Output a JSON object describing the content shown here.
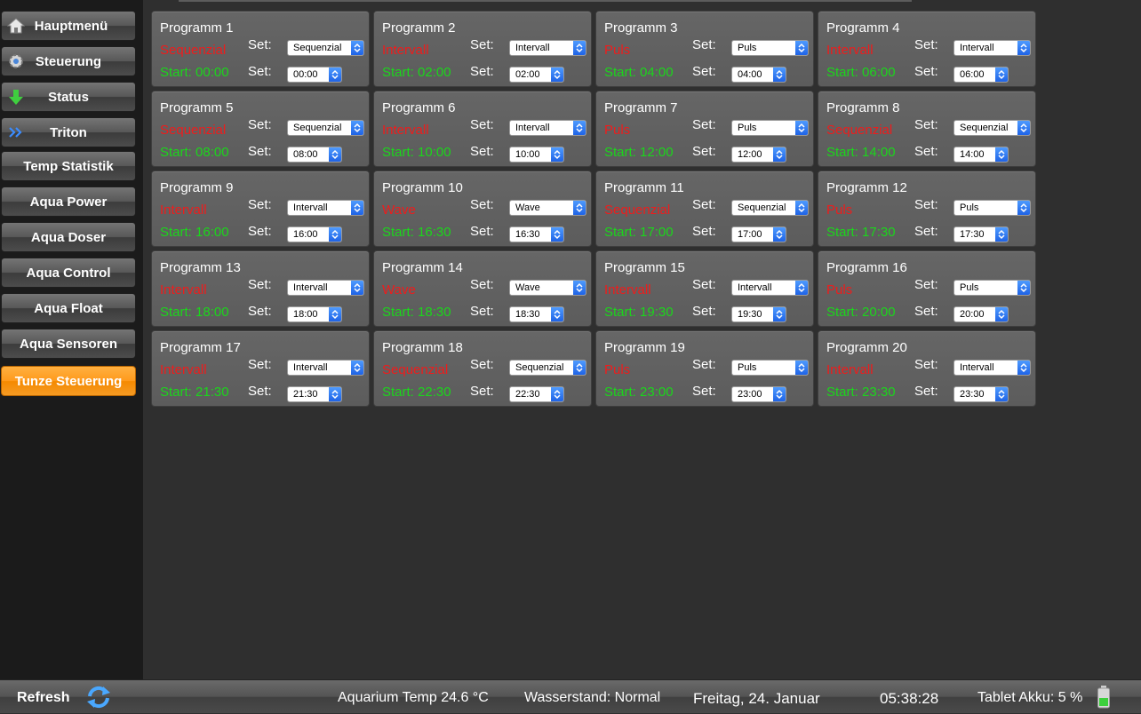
{
  "sidebar": {
    "items": [
      {
        "label": "Hauptmenü",
        "icon": "house-icon"
      },
      {
        "label": "Steuerung",
        "icon": "gear-icon"
      },
      {
        "label": "Status",
        "icon": "arrow-down-icon"
      },
      {
        "label": "Triton",
        "icon": "double-chevron-right-icon"
      },
      {
        "label": "Temp Statistik"
      },
      {
        "label": "Aqua Power"
      },
      {
        "label": "Aqua Doser"
      },
      {
        "label": "Aqua Control"
      },
      {
        "label": "Aqua Float"
      },
      {
        "label": "Aqua Sensoren"
      },
      {
        "label": "Tunze Steuerung",
        "active": true
      }
    ]
  },
  "set_label": "Set:",
  "programs": [
    {
      "title": "Programm 1",
      "mode": "Sequenzial",
      "start": "Start: 00:00",
      "set_mode": "Sequenzial",
      "set_time": "00:00"
    },
    {
      "title": "Programm 2",
      "mode": "Intervall",
      "start": "Start: 02:00",
      "set_mode": "Intervall",
      "set_time": "02:00"
    },
    {
      "title": "Programm 3",
      "mode": "Puls",
      "start": "Start: 04:00",
      "set_mode": "Puls",
      "set_time": "04:00"
    },
    {
      "title": "Programm 4",
      "mode": "Intervall",
      "start": "Start: 06:00",
      "set_mode": "Intervall",
      "set_time": "06:00"
    },
    {
      "title": "Programm 5",
      "mode": "Sequenzial",
      "start": "Start: 08:00",
      "set_mode": "Sequenzial",
      "set_time": "08:00"
    },
    {
      "title": "Programm 6",
      "mode": "Intervall",
      "start": "Start: 10:00",
      "set_mode": "Intervall",
      "set_time": "10:00"
    },
    {
      "title": "Programm 7",
      "mode": "Puls",
      "start": "Start: 12:00",
      "set_mode": "Puls",
      "set_time": "12:00"
    },
    {
      "title": "Programm 8",
      "mode": "Sequenzial",
      "start": "Start: 14:00",
      "set_mode": "Sequenzial",
      "set_time": "14:00"
    },
    {
      "title": "Programm 9",
      "mode": "Intervall",
      "start": "Start: 16:00",
      "set_mode": "Intervall",
      "set_time": "16:00"
    },
    {
      "title": "Programm 10",
      "mode": "Wave",
      "start": "Start: 16:30",
      "set_mode": "Wave",
      "set_time": "16:30"
    },
    {
      "title": "Programm 11",
      "mode": "Sequenzial",
      "start": "Start: 17:00",
      "set_mode": "Sequenzial",
      "set_time": "17:00"
    },
    {
      "title": "Programm 12",
      "mode": "Puls",
      "start": "Start: 17:30",
      "set_mode": "Puls",
      "set_time": "17:30"
    },
    {
      "title": "Programm 13",
      "mode": "Intervall",
      "start": "Start: 18:00",
      "set_mode": "Intervall",
      "set_time": "18:00"
    },
    {
      "title": "Programm 14",
      "mode": "Wave",
      "start": "Start: 18:30",
      "set_mode": "Wave",
      "set_time": "18:30"
    },
    {
      "title": "Programm 15",
      "mode": "Intervall",
      "start": "Start: 19:30",
      "set_mode": "Intervall",
      "set_time": "19:30"
    },
    {
      "title": "Programm 16",
      "mode": "Puls",
      "start": "Start: 20:00",
      "set_mode": "Puls",
      "set_time": "20:00"
    },
    {
      "title": "Programm 17",
      "mode": "Intervall",
      "start": "Start: 21:30",
      "set_mode": "Intervall",
      "set_time": "21:30"
    },
    {
      "title": "Programm 18",
      "mode": "Sequenzial",
      "start": "Start: 22:30",
      "set_mode": "Sequenzial",
      "set_time": "22:30"
    },
    {
      "title": "Programm 19",
      "mode": "Puls",
      "start": "Start: 23:00",
      "set_mode": "Puls",
      "set_time": "23:00"
    },
    {
      "title": "Programm 20",
      "mode": "Intervall",
      "start": "Start: 23:30",
      "set_mode": "Intervall",
      "set_time": "23:30"
    }
  ],
  "footer": {
    "refresh": "Refresh",
    "temp": "Aquarium Temp 24.6 °C",
    "water": "Wasserstand: Normal",
    "date": "Freitag, 24. Januar",
    "time": "05:38:28",
    "battery": "Tablet Akku: 5 %"
  },
  "colors": {
    "mode_text": "#ee1c1c",
    "start_text": "#1bd61b",
    "active_nav": "#ff9a1c",
    "select_caret": "#1e63e6"
  }
}
